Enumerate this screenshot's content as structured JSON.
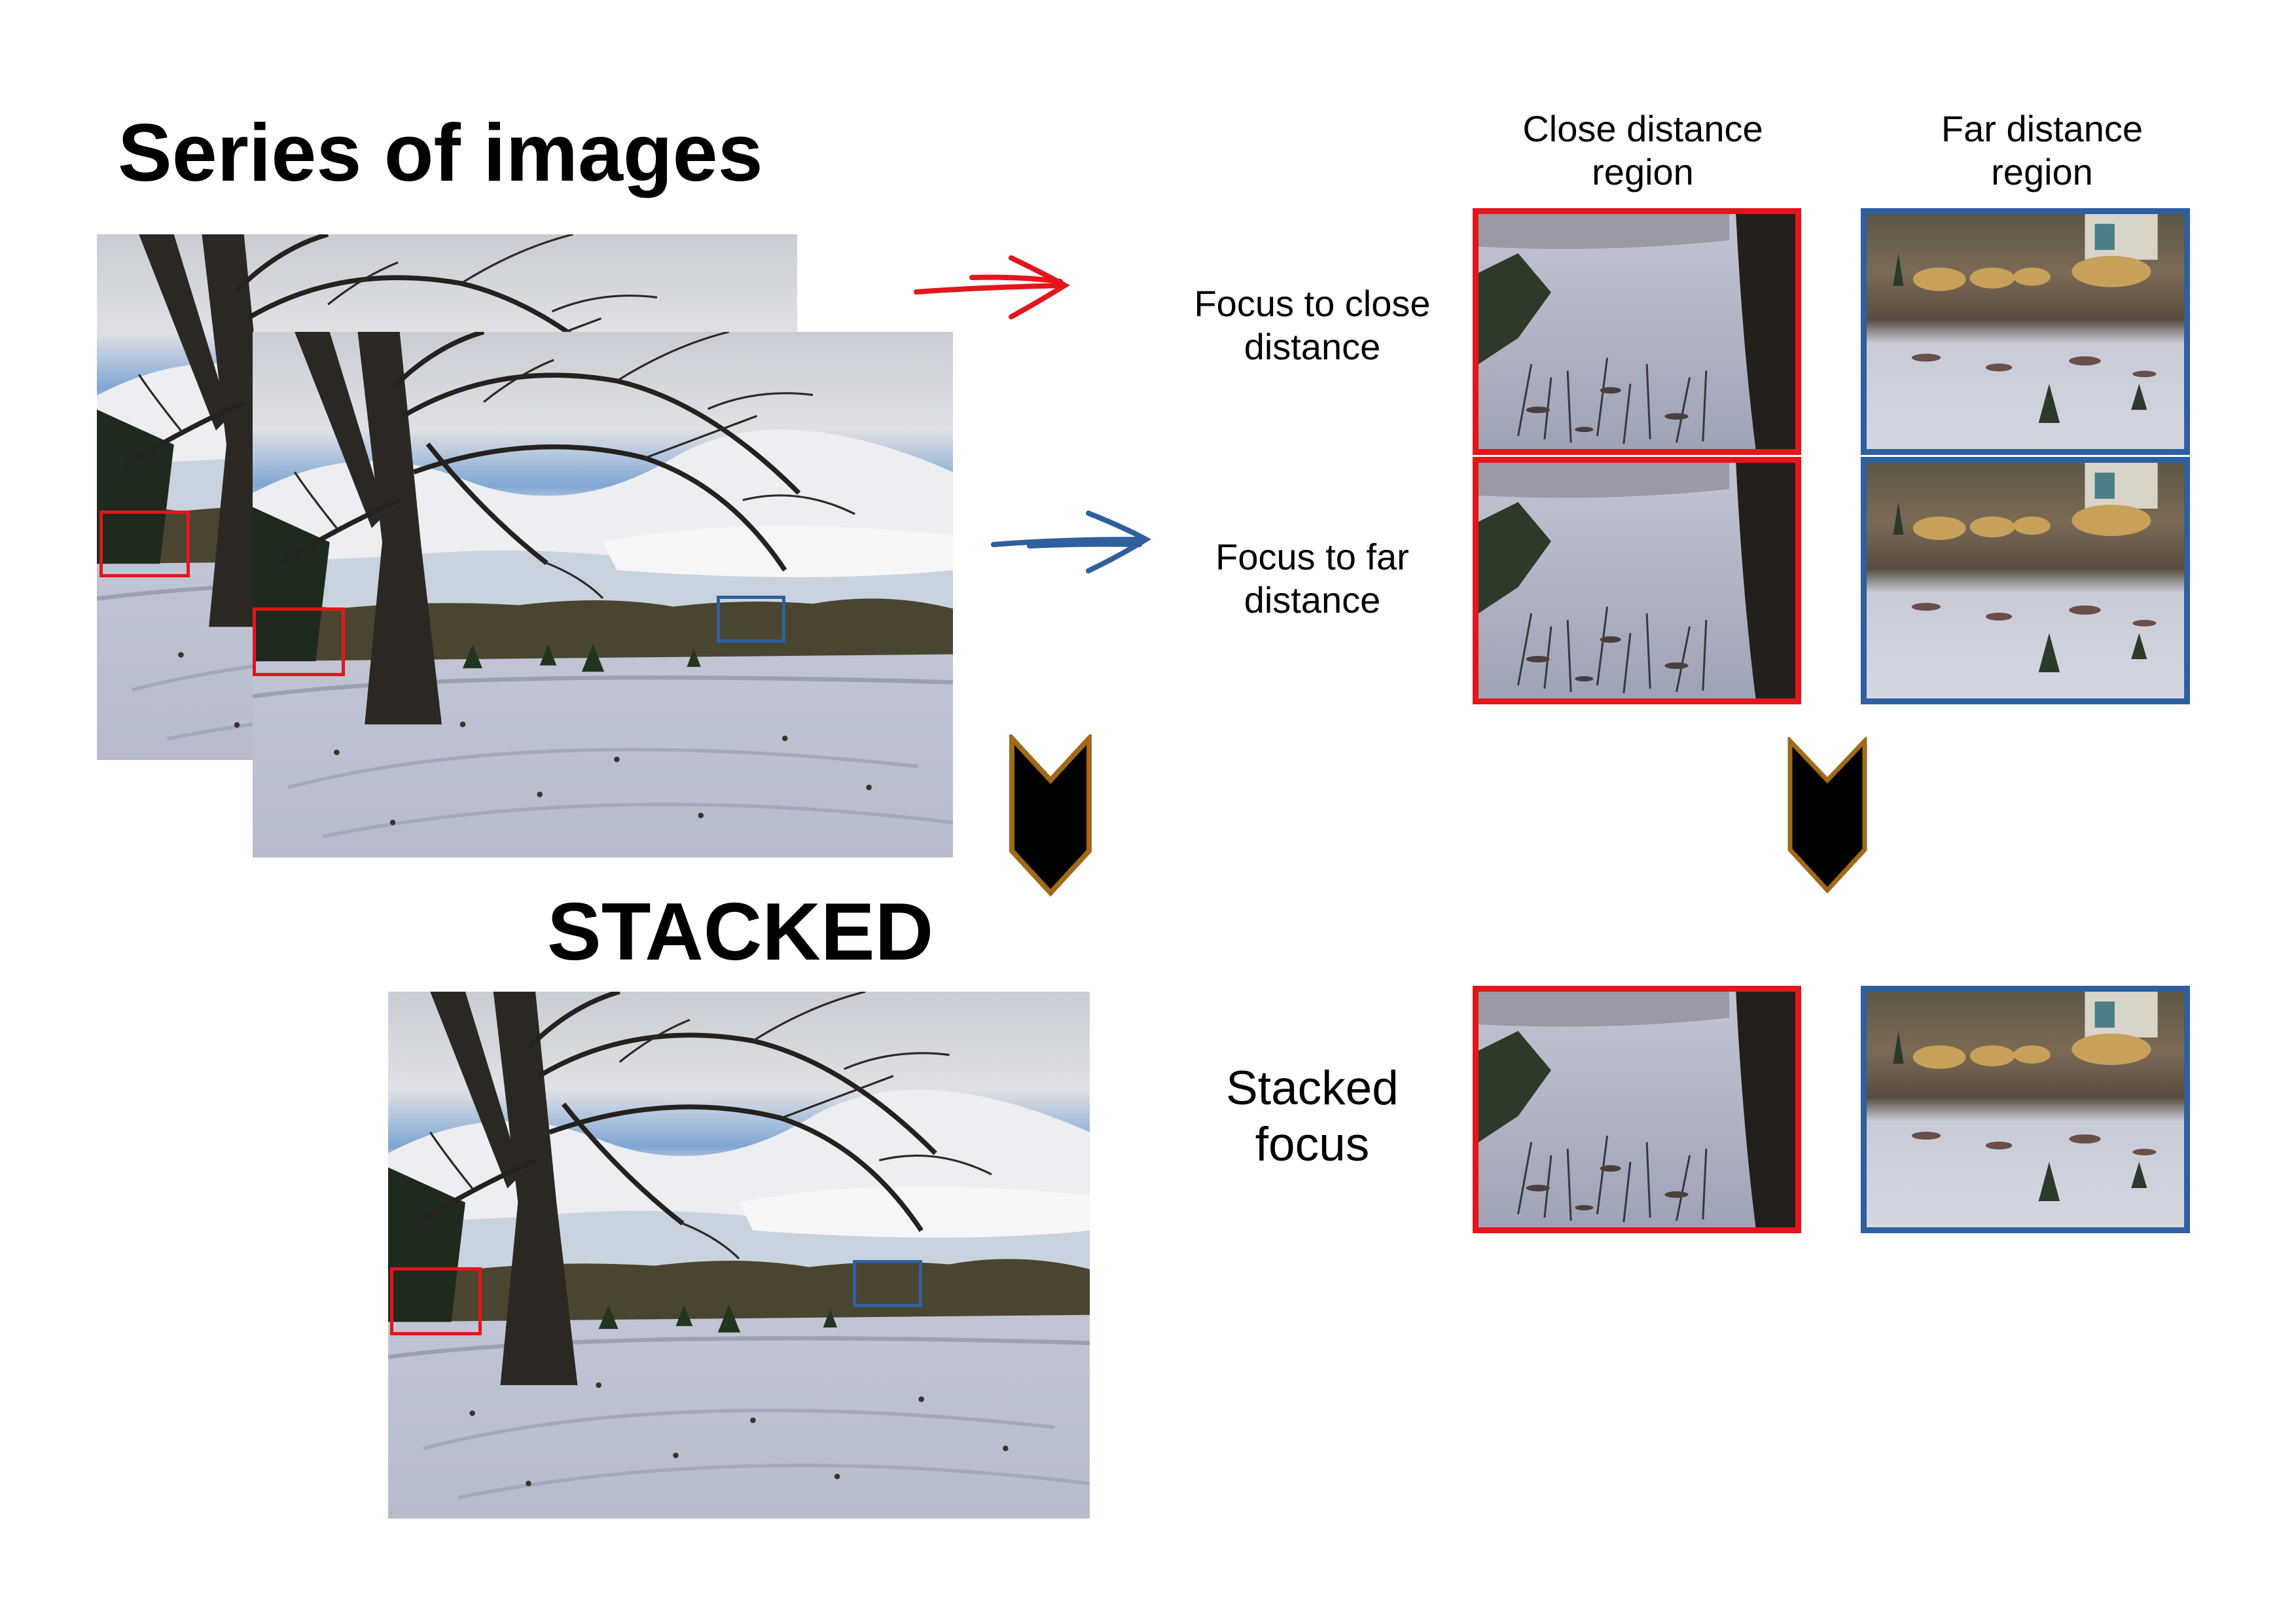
{
  "heading_series": "Series of images",
  "heading_stacked": "STACKED",
  "column_headers": {
    "close": "Close distance\nregion",
    "far": "Far distance\nregion"
  },
  "row_labels": {
    "focus_close": "Focus to close\ndistance",
    "focus_far": "Focus to far\ndistance",
    "stacked": "Stacked\nfocus"
  },
  "colors": {
    "close_region": "#e3161b",
    "far_region": "#2f5f9e",
    "chevron_fill": "#000000",
    "chevron_outline": "#a06a18"
  },
  "icons": {
    "arrow_close": "hand-drawn-arrow-right-red",
    "arrow_far": "hand-drawn-arrow-right-blue",
    "chevron_left": "chevron-down-icon",
    "chevron_right": "chevron-down-icon"
  }
}
